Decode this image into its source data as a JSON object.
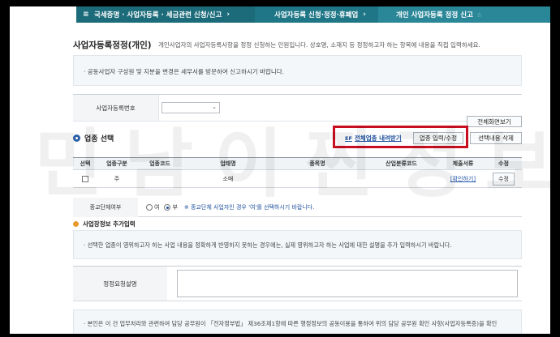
{
  "breadcrumb": {
    "items": [
      {
        "label": "국세증명 · 사업자등록 · 세금관련 신청/신고",
        "icon": "menu-icon"
      },
      {
        "label": "사업자등록 신청·정정·휴폐업",
        "icon": "chevron-right-icon"
      },
      {
        "label": "개인 사업자등록 정정 신고",
        "icon": "star-icon"
      }
    ]
  },
  "page": {
    "title": "사업자등록정정(개인)",
    "description": "개인사업자의 사업자등록사항을 정정 신청하는 민원입니다. 상호명, 소재지 등 정정하고자 하는 항목에 내용을 직접 입력하세요."
  },
  "notice_top": "· 공동사업자 구성원 및 지분을 변경은 세무서를 방문하여 신고하시기 바랍니다.",
  "business_number": {
    "label": "사업자등록번호",
    "value": ""
  },
  "buttons": {
    "full_screen": "전체화면보기",
    "industry_edit": "업종 입력/수정",
    "delete_selected": "선택내용 삭제",
    "download_all": "전체업종 내려받기"
  },
  "section_industry": {
    "title": "업종 선택"
  },
  "table": {
    "headers": [
      "선택",
      "업종구분",
      "업종코드",
      "업태명",
      "종목명",
      "산업분류코드",
      "제출서류",
      "수정"
    ],
    "rows": [
      {
        "type": "주",
        "code": "",
        "business": "소매",
        "item": "",
        "industry_code": "",
        "docs": "[확인하기]",
        "edit": "수정"
      }
    ]
  },
  "religion": {
    "label": "종교단체여부",
    "options": [
      "여",
      "부"
    ],
    "selected": "부",
    "hint": "※ 종교단체 사업자인 경우 '여'를 선택하시기 바랍니다."
  },
  "section_place": {
    "title": "사업장정보 추가입력"
  },
  "notice_mid": "· 선택한 업종이 영위하고자 하는 사업 내용을 정확하게 반영하지 못하는 경우에는, 실제 영위하고자 하는 사업에 대한 설명을 추가 입력하시기 바랍니다.",
  "explain": {
    "label": "정정요청설명",
    "value": ""
  },
  "notice_bottom": "· 본인은 이 건 업무처리와 관련하여 담당 공무원이 「전자정부법」 제36조제1항에 따른 행정정보의 공동이용을 통하여 위의 담당 공무원 확인 사항(사업자등록증)을 확인",
  "watermark": [
    "민",
    "남",
    "이",
    "찐",
    "정",
    "보"
  ]
}
